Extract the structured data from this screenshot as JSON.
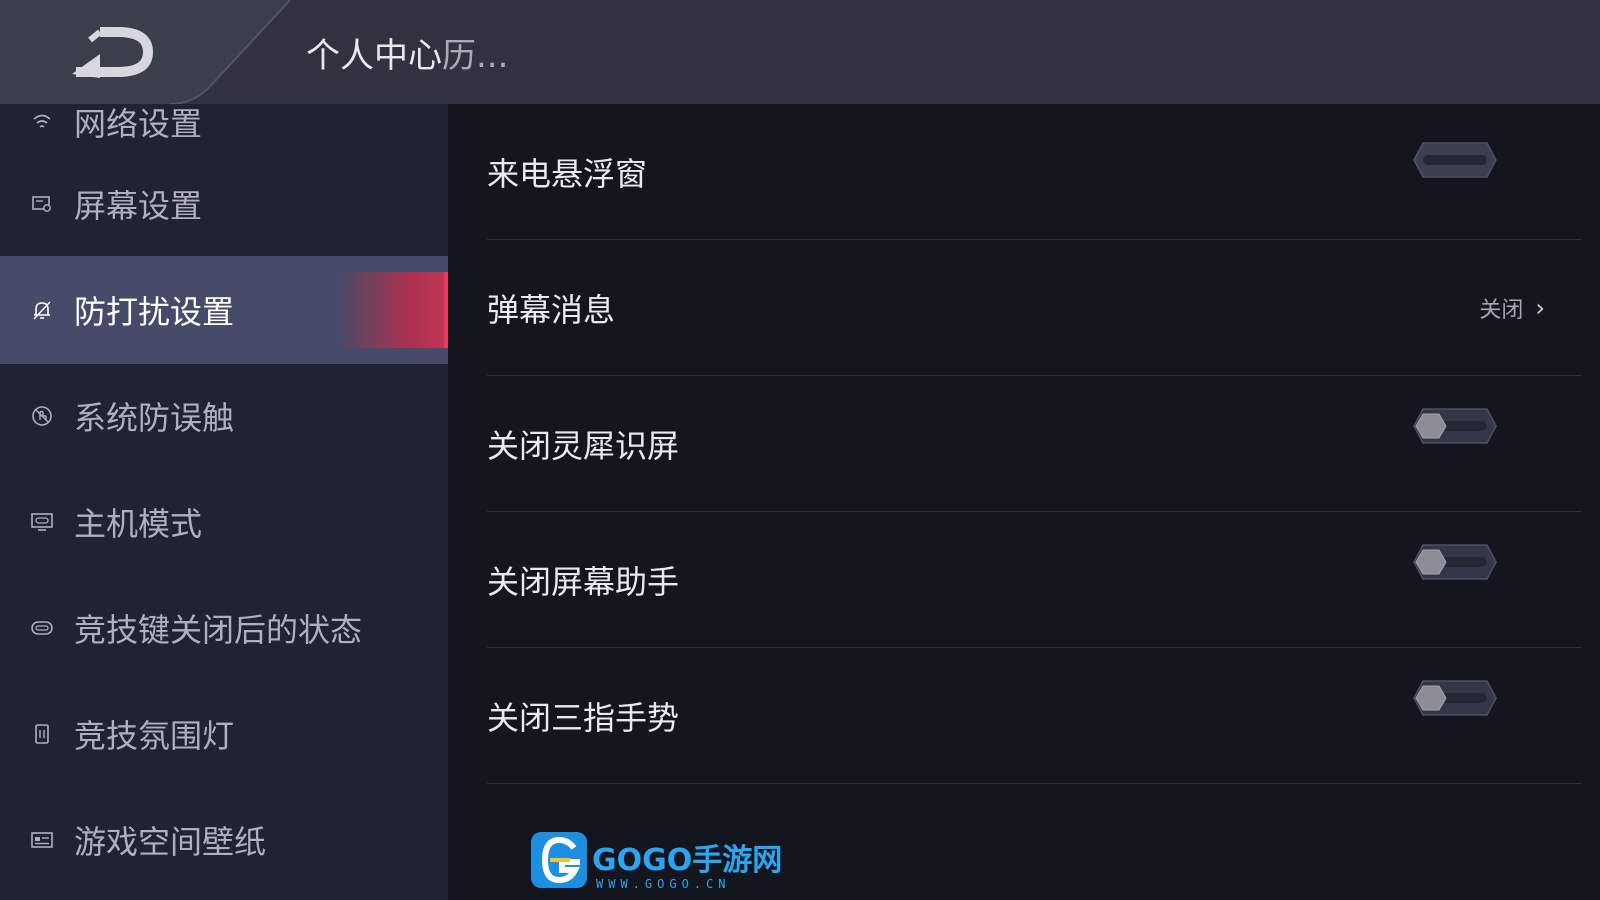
{
  "header": {
    "title": "个人中心",
    "title_suffix": "历..."
  },
  "sidebar": {
    "items": [
      {
        "label": "网络设置",
        "icon": "network-icon"
      },
      {
        "label": "屏幕设置",
        "icon": "screen-settings-icon"
      },
      {
        "label": "防打扰设置",
        "icon": "bell-icon",
        "active": true
      },
      {
        "label": "系统防误触",
        "icon": "touch-block-icon"
      },
      {
        "label": "主机模式",
        "icon": "console-icon"
      },
      {
        "label": "竞技键关闭后的状态",
        "icon": "switch-key-icon"
      },
      {
        "label": "竞技氛围灯",
        "icon": "ambient-light-icon"
      },
      {
        "label": "游戏空间壁纸",
        "icon": "wallpaper-icon"
      }
    ]
  },
  "settings": [
    {
      "label": "来电悬浮窗",
      "control": "toggle",
      "state": "disabled"
    },
    {
      "label": "弹幕消息",
      "control": "link",
      "value": "关闭"
    },
    {
      "label": "关闭灵犀识屏",
      "control": "toggle",
      "state": "off"
    },
    {
      "label": "关闭屏幕助手",
      "control": "toggle",
      "state": "off"
    },
    {
      "label": "关闭三指手势",
      "control": "toggle",
      "state": "off"
    }
  ],
  "watermark": {
    "brand": "GOGO手游网",
    "url": "WWW.GOGO.CN"
  },
  "colors": {
    "header_bg": "#30333f",
    "sidebar_bg": "#202331",
    "content_bg": "#14161f",
    "active_item_bg": "#474b6a",
    "accent": "#c33556"
  }
}
